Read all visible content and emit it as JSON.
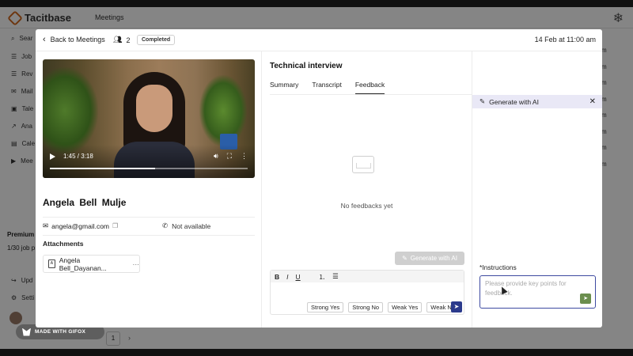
{
  "app": {
    "brand": "Tacitbase",
    "section": "Meetings",
    "sidebar_items": [
      "Sear",
      "Job",
      "Rev",
      "Mail",
      "Tale",
      "Ana",
      "Cale",
      "Mee"
    ],
    "sidebar_premium": "Premium",
    "sidebar_jobs": "1/30 job p",
    "sidebar_items_bottom": [
      "Upd",
      "Setti"
    ],
    "user_initials": "An",
    "right_col_items": [
      "m",
      "m",
      "m",
      "m",
      "m",
      "m",
      "m",
      "m",
      "m",
      "m"
    ],
    "page_number": "1",
    "watermark": "MADE WITH GIFOX"
  },
  "modal": {
    "back_label": "Back to Meetings",
    "participants_count": "2",
    "status": "Completed",
    "datetime": "14 Feb at 11:00 am"
  },
  "video": {
    "time": "1:45 / 3:18",
    "progress": 0.53
  },
  "candidate": {
    "first_name": "Angela Bell",
    "last_name": "Mulje",
    "email": "angela@gmail.com",
    "phone": "Not available"
  },
  "attachments": {
    "title": "Attachments",
    "items": [
      {
        "name": "Angela Bell_Dayanan...",
        "more": "···"
      }
    ]
  },
  "interview": {
    "title": "Technical interview",
    "tabs": [
      {
        "label": "Summary",
        "active": false
      },
      {
        "label": "Transcript",
        "active": false
      },
      {
        "label": "Feedback",
        "active": true
      }
    ],
    "empty_text": "No feedbacks yet",
    "generate_label": "Generate with AI",
    "quick_replies": [
      "Strong Yes",
      "Strong No",
      "Weak Yes",
      "Weak No"
    ]
  },
  "ai_panel": {
    "title": "Generate with AI",
    "instructions_label": "*Instructions",
    "placeholder": "Please provide key points for feedback."
  },
  "colors": {
    "accent": "#2b3a8c",
    "ai_header_bg": "#e9e8f6",
    "send_green": "#6b8e4e"
  }
}
